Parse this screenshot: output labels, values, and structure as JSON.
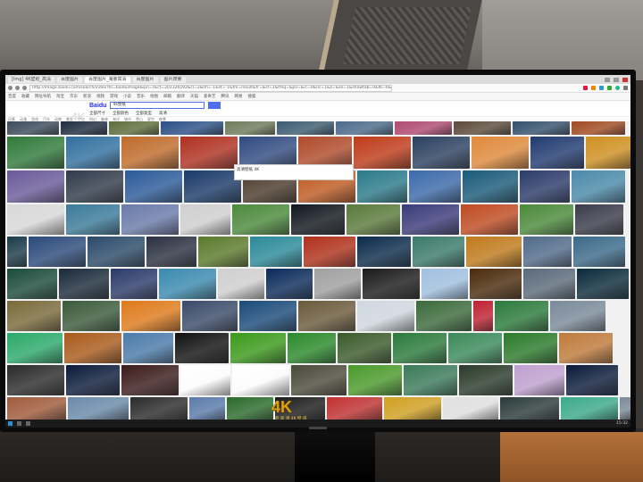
{
  "scene": {
    "description_free": true
  },
  "browser": {
    "tabs": [
      {
        "label": "[Img] 4K壁纸_高清",
        "active": false
      },
      {
        "label": "百度图片",
        "active": false
      },
      {
        "label": "百度图片_海量高清",
        "active": true
      },
      {
        "label": "百度图片",
        "active": false
      },
      {
        "label": "图片搜索",
        "active": false
      }
    ],
    "url": "http://image.baidu.com/search/index?tn=baiduimage&ipn=r&ct=201326592&cl=2&lm=-1&st=-1&fm=result&fr=&sf=1&fmq=&pv=&ic=0&nc=1&z=&se=1&showtab=0&fb=0&width=&height=&face=0&istype=2&ie=utf-8&word=4k壁纸",
    "bookmarks": [
      "百度",
      "收藏",
      "网址导航",
      "淘宝",
      "京东",
      "新浪",
      "视频",
      "游戏",
      "小说",
      "音乐",
      "地图",
      "邮箱",
      "翻译",
      "天猫",
      "爱奇艺",
      "腾讯",
      "网易",
      "搜狐"
    ],
    "search": {
      "logo_main": "Bai",
      "logo_accent": "du",
      "query": "4k壁纸"
    },
    "filters": [
      "全部尺寸",
      "全部颜色",
      "全部类型",
      "高清"
    ],
    "chips": [
      "风景",
      "动漫",
      "游戏",
      "汽车",
      "动物",
      "美女",
      "宇宙",
      "科幻",
      "森林",
      "海洋",
      "城市",
      "雪山",
      "星空",
      "夜景"
    ],
    "hover_tip": "高清壁纸 4K",
    "badge_top": "4K",
    "badge_bottom": "4K",
    "badge_sub": "超 高 清 4K 壁 纸"
  },
  "taskbar": {
    "clock": "15:32"
  },
  "grid_rows": [
    {
      "h": 15,
      "tiles": [
        [
          "#3a4a5a",
          58
        ],
        [
          "#1d2b3e",
          52
        ],
        [
          "#5d6d3a",
          56
        ],
        [
          "#2a4f86",
          70
        ],
        [
          "#6d7b5a",
          56
        ],
        [
          "#3c5b70",
          64
        ],
        [
          "#4a6a8a",
          64
        ],
        [
          "#b04a70",
          64
        ],
        [
          "#5b4a3a",
          64
        ],
        [
          "#34506d",
          64
        ],
        [
          "#a04a20",
          60
        ]
      ]
    },
    {
      "h": 36,
      "tiles": [
        [
          "#2f7a3a",
          64
        ],
        [
          "#3070a0",
          60
        ],
        [
          "#c06b2a",
          64
        ],
        [
          "#b03020",
          64
        ],
        [
          "#304a80",
          64
        ],
        [
          "#b04a2a",
          60
        ],
        [
          "#c03a18",
          64
        ],
        [
          "#2a4060",
          64
        ],
        [
          "#e08a3a",
          64
        ],
        [
          "#203a70",
          60
        ],
        [
          "#d09020",
          50
        ]
      ]
    },
    {
      "h": 36,
      "tiles": [
        [
          "#6a5a9a",
          64
        ],
        [
          "#303a4a",
          64
        ],
        [
          "#2a5a9a",
          64
        ],
        [
          "#1a3a6a",
          64
        ],
        [
          "#4a3a2a",
          60
        ],
        [
          "#c05a20",
          64
        ],
        [
          "#2a7a8a",
          56
        ],
        [
          "#3a6aaa",
          58
        ],
        [
          "#1a5a7a",
          62
        ],
        [
          "#2a3a6a",
          56
        ],
        [
          "#4a8aaa",
          60
        ]
      ]
    },
    {
      "h": 34,
      "tiles": [
        [
          "#d9d9d9",
          64
        ],
        [
          "#3a7a9a",
          60
        ],
        [
          "#6a7aaa",
          64
        ],
        [
          "#d0d0d0",
          56
        ],
        [
          "#4a8a3a",
          64
        ],
        [
          "#10161e",
          60
        ],
        [
          "#5a7a3a",
          60
        ],
        [
          "#3a3a7a",
          64
        ],
        [
          "#c04a20",
          64
        ],
        [
          "#4a8a3a",
          60
        ],
        [
          "#3a3a4a",
          54
        ]
      ]
    },
    {
      "h": 34,
      "tiles": [
        [
          "#1a3a4a",
          22
        ],
        [
          "#2a4a7a",
          64
        ],
        [
          "#2a4a6a",
          64
        ],
        [
          "#2a3040",
          56
        ],
        [
          "#5a7a2a",
          56
        ],
        [
          "#2a8a9a",
          58
        ],
        [
          "#b0301a",
          58
        ],
        [
          "#0a2a4a",
          60
        ],
        [
          "#3a7a6a",
          58
        ],
        [
          "#c07a1a",
          62
        ],
        [
          "#506a8a",
          54
        ],
        [
          "#3a6a8a",
          58
        ]
      ]
    },
    {
      "h": 34,
      "tiles": [
        [
          "#1a4a3a",
          56
        ],
        [
          "#1a2a3a",
          56
        ],
        [
          "#2a3a6a",
          52
        ],
        [
          "#3a8ab0",
          64
        ],
        [
          "#d0d0d0",
          52
        ],
        [
          "#0a2a5a",
          52
        ],
        [
          "#a0a0a0",
          52
        ],
        [
          "#1a1a1a",
          64
        ],
        [
          "#a0c0e0",
          52
        ],
        [
          "#4a2a0a",
          58
        ],
        [
          "#5a6a7a",
          58
        ],
        [
          "#0a2a3a",
          58
        ]
      ]
    },
    {
      "h": 34,
      "tiles": [
        [
          "#7a6a3a",
          60
        ],
        [
          "#3a5a3a",
          64
        ],
        [
          "#e07a1a",
          66
        ],
        [
          "#3a4a6a",
          62
        ],
        [
          "#1a4a7a",
          64
        ],
        [
          "#6a5a3a",
          64
        ],
        [
          "#d0d8e0",
          64
        ],
        [
          "#3a6a3a",
          62
        ],
        [
          "#c02030",
          22
        ],
        [
          "#2a7a3a",
          60
        ],
        [
          "#7a8a9a",
          62
        ]
      ]
    },
    {
      "h": 34,
      "tiles": [
        [
          "#2aaa6a",
          62
        ],
        [
          "#aa5a1a",
          64
        ],
        [
          "#4a7aaa",
          56
        ],
        [
          "#101010",
          60
        ],
        [
          "#3a9a1a",
          62
        ],
        [
          "#2a8a2a",
          54
        ],
        [
          "#3a5a2a",
          60
        ],
        [
          "#2a7a3a",
          60
        ],
        [
          "#3a8a5a",
          60
        ],
        [
          "#2a7a2a",
          60
        ],
        [
          "#c07a3a",
          60
        ]
      ]
    },
    {
      "h": 34,
      "tiles": [
        [
          "#2a2a2a",
          64
        ],
        [
          "#0a1a3a",
          60
        ],
        [
          "#3a1a1a",
          64
        ],
        [
          "#ffffff",
          56
        ],
        [
          "#ffffff",
          64
        ],
        [
          "#4a4a3a",
          62
        ],
        [
          "#4a9a2a",
          60
        ],
        [
          "#3a7a5a",
          60
        ],
        [
          "#2a3a2a",
          60
        ],
        [
          "#c0a0d0",
          56
        ],
        [
          "#0a1a3a",
          58
        ]
      ]
    },
    {
      "h": 26,
      "tiles": [
        [
          "#a05a3a",
          66
        ],
        [
          "#6a8aaa",
          68
        ],
        [
          "#2a2a2a",
          64
        ],
        [
          "#5a7aaa",
          40
        ],
        [
          "#2a6a2a",
          52
        ],
        [
          "#1a1a1a",
          56
        ],
        [
          "#c03030",
          62
        ],
        [
          "#d0a020",
          64
        ],
        [
          "#e0e0e0",
          62
        ],
        [
          "#2a3a3a",
          66
        ],
        [
          "#3aaa8a",
          64
        ],
        [
          "#7a8a9a",
          60
        ]
      ]
    }
  ]
}
